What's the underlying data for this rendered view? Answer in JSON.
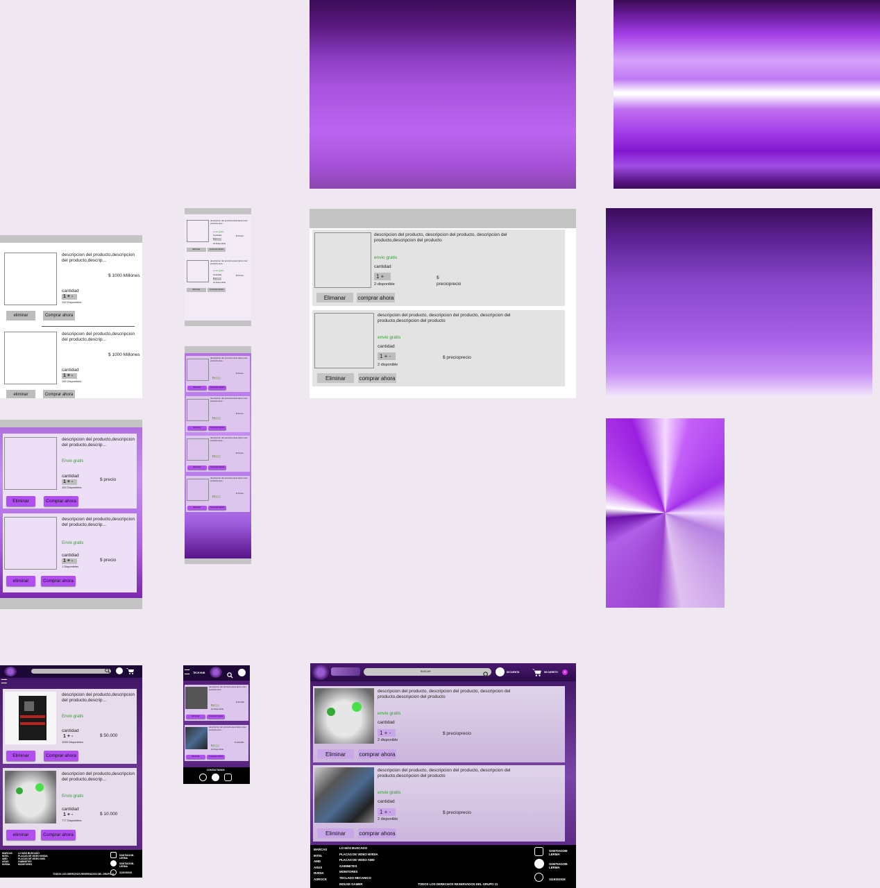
{
  "colors": {
    "accent": "#b04ef0",
    "bg": "#f0e8f0",
    "dark": "#1a0625",
    "gray": "#c4c4c4",
    "green": "#2aa02a"
  },
  "text": {
    "desc_short": "descripcion del producto,descripcion del producto,descrip...",
    "desc_long": "descripcion del producto, descripcion del producto, descripcion del producto,descripcion del producto",
    "desc_tiny": "descripcion del producto,descripcion del producto,des...",
    "envio_lower": "envio  gratis",
    "envio_title": "Envio gratis",
    "cantidad": "cantidad",
    "Cantidad": "Cantidad",
    "qty": "1 + -",
    "qty_short": "1 +",
    "qty_small": "1 + ·",
    "disp_100": "100 Disponibles",
    "disp_2": "2 disponible",
    "disp_2b": "2-disponible",
    "disp_1": "1 Disponibles",
    "disp_10": "10 Disponible",
    "disp_1000": "1000 Disponibles",
    "disp_777": "777 Disponibles",
    "price_1000": "$ 1000 Millones",
    "price_p": "$ precio",
    "price_pp": "$ precioprecio",
    "price_s": "$",
    "price_pp_only": "precioprecio",
    "price_50": "$ 50.000",
    "price_10": "$ 10.000",
    "price_30": "$ 30.000",
    "price_100": "$ 100.000",
    "price_tiny": "$ Precio",
    "btn_eliminar_l": "eliminar",
    "btn_Eliminar": "Eliminar",
    "btn_Elimanar": "Elimanar",
    "btn_comprar": "Comprar ahora",
    "btn_comprar_l": "comprar ahora",
    "buscar": "BUSCAR",
    "mi_cuenta": "MI CUENTA",
    "mi_carrito": "MI CARRITO",
    "cart_count": "0",
    "tech_hub": "TECH HUB",
    "contactanos": "CONTACTANOS",
    "copyright": "TODOS LOS DERECHOS RESERVADOS DEL GRUPO 11",
    "footer_col1": [
      "MARCAS",
      "INTEL",
      "AMD",
      "ASUS",
      "NVIDIA",
      "ASROCK"
    ],
    "footer_col2": [
      "LO MÁS BUSCADO",
      "PLACAS DE VIDEO NVIDIA",
      "PLACAS DE VIDEO AMD",
      "GABINETES",
      "MONITORES",
      "TECLADO MECANICO",
      "MOUSE GAMER"
    ],
    "instagram": "SANTIAGOB-LERMA",
    "facebook": "SANTIAGOB-LERMA",
    "phone": "1115151515"
  }
}
